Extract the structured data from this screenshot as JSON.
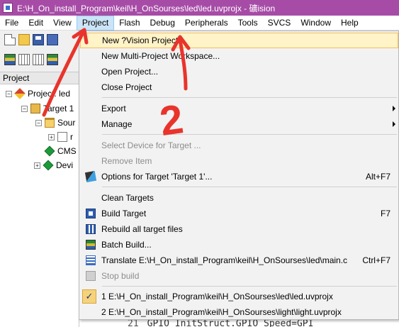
{
  "window": {
    "title": "E:\\H_On_install_Program\\keil\\H_OnSourses\\led\\led.uvprojx - 礦ision"
  },
  "menubar": {
    "items": [
      "File",
      "Edit",
      "View",
      "Project",
      "Flash",
      "Debug",
      "Peripherals",
      "Tools",
      "SVCS",
      "Window",
      "Help"
    ],
    "active": "Project"
  },
  "panel": {
    "title": "Project",
    "tree": [
      {
        "label": "Project: led",
        "expander": "−",
        "icon": "project-icon"
      },
      {
        "label": "Target 1",
        "expander": "−",
        "icon": "target-icon"
      },
      {
        "label": "Sour",
        "expander": "−",
        "icon": "folder-icon"
      },
      {
        "label": "r",
        "expander": "+",
        "icon": "file-icon"
      },
      {
        "label": "CMS",
        "expander": "",
        "icon": "gem-icon"
      },
      {
        "label": "Devi",
        "expander": "+",
        "icon": "gem-icon"
      }
    ]
  },
  "dropdown": {
    "items": [
      {
        "label": "New ?Vision Project...",
        "shortcut": "",
        "state": "highlight"
      },
      {
        "label": "New Multi-Project Workspace...",
        "shortcut": ""
      },
      {
        "label": "Open Project...",
        "shortcut": ""
      },
      {
        "label": "Close Project",
        "shortcut": ""
      },
      {
        "label": "Export",
        "shortcut": "",
        "submenu": true
      },
      {
        "label": "Manage",
        "shortcut": "",
        "submenu": true
      },
      {
        "label": "Select Device for Target ...",
        "shortcut": "",
        "state": "disabled"
      },
      {
        "label": "Remove Item",
        "shortcut": "",
        "state": "disabled"
      },
      {
        "label": "Options for Target 'Target 1'...",
        "shortcut": "Alt+F7",
        "icon": "wand-icon"
      },
      {
        "label": "Clean Targets",
        "shortcut": ""
      },
      {
        "label": "Build Target",
        "shortcut": "F7",
        "icon": "build-icon"
      },
      {
        "label": "Rebuild all target files",
        "shortcut": "",
        "icon": "rebuild-icon"
      },
      {
        "label": "Batch Build...",
        "shortcut": "",
        "icon": "batch-build-icon"
      },
      {
        "label": "Translate E:\\H_On_install_Program\\keil\\H_OnSourses\\led\\main.c",
        "shortcut": "Ctrl+F7",
        "icon": "translate-icon"
      },
      {
        "label": "Stop build",
        "shortcut": "",
        "state": "disabled",
        "icon": "stop-build-icon"
      },
      {
        "label": "1 E:\\H_On_install_Program\\keil\\H_OnSourses\\led\\led.uvprojx",
        "shortcut": "",
        "checked": true
      },
      {
        "label": "2 E:\\H_On_install_Program\\keil\\H_OnSourses\\light\\light.uvprojx",
        "shortcut": ""
      }
    ],
    "check_mark": "✓"
  },
  "editor": {
    "line_number": "21",
    "code": "GPIO_InitStruct.GPIO_Speed=GPI"
  },
  "annotations": {
    "number_label": "2",
    "color": "#e8342c"
  }
}
